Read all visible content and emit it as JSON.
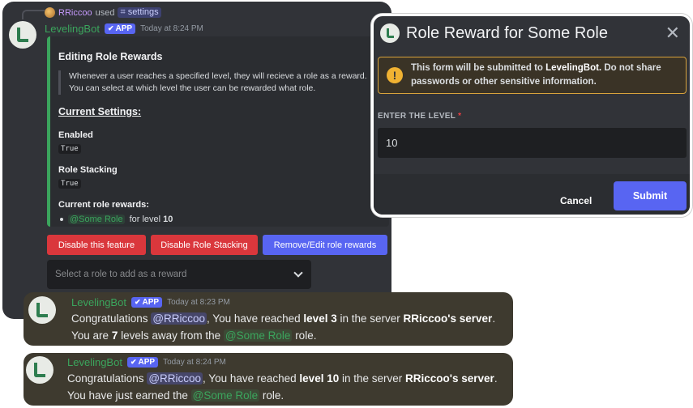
{
  "command_reply": {
    "user": "RRiccoo",
    "used_text": "used",
    "command": "settings"
  },
  "bot": {
    "name": "LevelingBot",
    "badge": "APP",
    "timestamp": "Today at 8:24 PM"
  },
  "embed": {
    "title": "Editing Role Rewards",
    "description_line1": "Whenever a user reaches a specified level, they will recieve a role as a reward.",
    "description_line2": "You can select at which level the user can be rewarded what role.",
    "section_title": "Current Settings:",
    "enabled_label": "Enabled",
    "enabled_value": "True",
    "stacking_label": "Role Stacking",
    "stacking_value": "True",
    "rewards_label": "Current role rewards:",
    "reward_role": "@Some Role",
    "reward_text": "for level",
    "reward_level": "10"
  },
  "buttons": {
    "disable_feature": "Disable this feature",
    "disable_stacking": "Disable Role Stacking",
    "remove_edit": "Remove/Edit role rewards"
  },
  "select": {
    "placeholder": "Select a role to add as a reward"
  },
  "modal": {
    "title": "Role Reward for Some Role",
    "warning_prefix": "This form will be submitted to",
    "warning_bot": "LevelingBot.",
    "warning_suffix": "Do not share passwords or other sensitive information.",
    "field_label": "ENTER THE LEVEL",
    "required_mark": "*",
    "field_value": "10",
    "cancel": "Cancel",
    "submit": "Submit"
  },
  "levelup1": {
    "name": "LevelingBot",
    "badge": "APP",
    "timestamp": "Today at 8:23 PM",
    "congrats": "Congratulations",
    "mention": "@RRiccoo",
    "reached": ", You have reached",
    "level": "level 3",
    "in_server": "in the server",
    "server": "RRiccoo's server",
    "period": ".",
    "you_are": "You are",
    "levels_away_count": "7",
    "levels_away": "levels away from the",
    "role": "@Some Role",
    "role_suffix": "role."
  },
  "levelup2": {
    "name": "LevelingBot",
    "badge": "APP",
    "timestamp": "Today at 8:24 PM",
    "congrats": "Congratulations",
    "mention": "@RRiccoo",
    "reached": ", You have reached",
    "level": "level 10",
    "in_server": "in the server",
    "server": "RRiccoo's server",
    "period": ".",
    "earned": "You have just earned the",
    "role": "@Some Role",
    "role_suffix": "role."
  }
}
